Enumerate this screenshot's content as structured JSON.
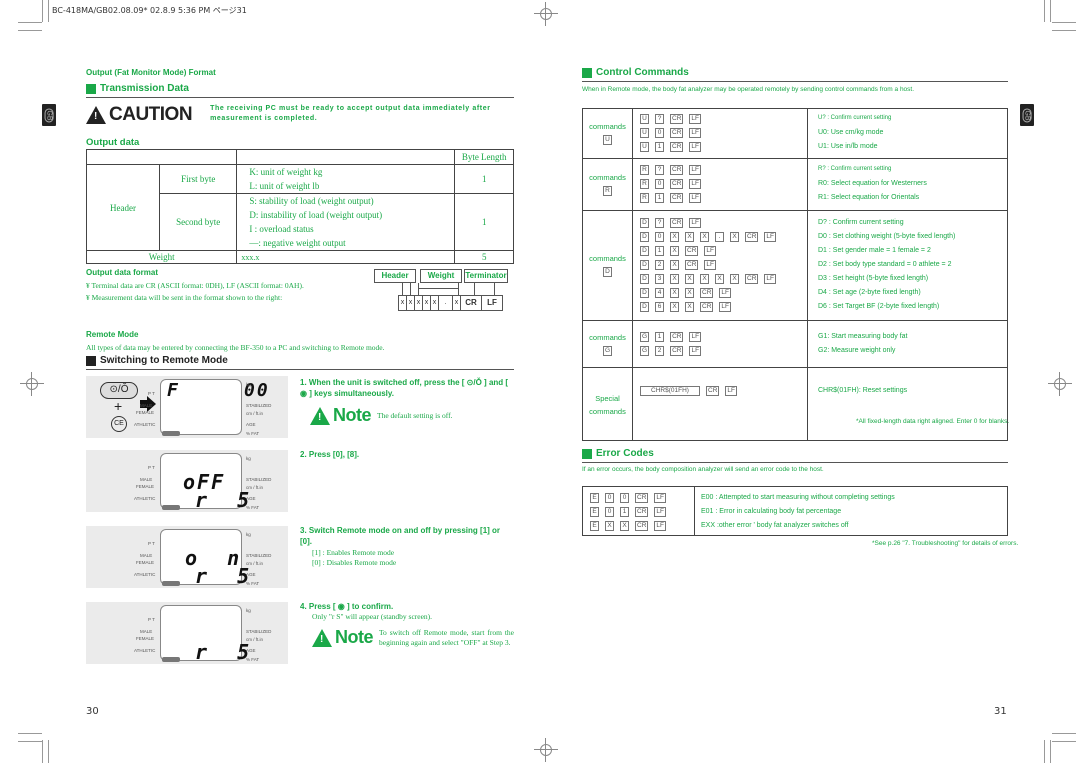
{
  "print_header": "BC-418MA/GB02.08.09* 02.8.9 5:36 PM ページ31",
  "gb_tab": "GB",
  "left_page": {
    "heading": "Output (Fat Monitor Mode) Format",
    "transmission_title": "Transmission Data",
    "caution": {
      "word": "CAUTION",
      "text": "The receiving PC must be ready to accept output data immediately after measurement is completed."
    },
    "output_data": {
      "title": "Output data",
      "byte_length_header": "Byte Length",
      "header_label": "Header",
      "first_byte": {
        "label": "First byte",
        "lines": [
          "K: unit of weight  kg",
          "L: unit of weight  lb"
        ],
        "length": "1"
      },
      "second_byte": {
        "label": "Second byte",
        "lines": [
          "S: stability of load (weight output)",
          "D: instability of load (weight output)",
          "I : overload status",
          "—: negative weight output"
        ],
        "length": "1"
      },
      "weight": {
        "label": "Weight",
        "value": "xxx.x",
        "length": "5"
      }
    },
    "output_format": {
      "title": "Output data format",
      "bullets": [
        "¥  Terminal data are CR (ASCII format: 0DH), LF (ASCII format: 0AH).",
        "¥  Measurement data will be sent in the format shown to the right:"
      ],
      "diagram": {
        "groups": [
          "Header",
          "Weight",
          "Terminator"
        ],
        "cells": [
          "x",
          "x",
          "x",
          "x",
          "x",
          ".",
          "x",
          "CR",
          "LF"
        ]
      }
    },
    "remote_mode": {
      "title": "Remote Mode",
      "text": "All types of data may be entered by connecting the BF-350 to a PC and switching to Remote mode."
    },
    "switching_title": "Switching to Remote Mode",
    "lcd_labels": {
      "left": [
        "P T",
        "MALE",
        "FEMALE",
        "ATHLETIC"
      ],
      "right": [
        "kg",
        "STABILIZED",
        "cm / ft.in",
        "AGE",
        "% FAT"
      ]
    },
    "keys": {
      "power": "⊙/Ǒ",
      "plus": "+",
      "ce": "CE"
    },
    "panels": [
      {
        "line1": "F     00",
        "line2": ""
      },
      {
        "line1": "oFF",
        "line2": "r  5"
      },
      {
        "line1": "o  n",
        "line2": "r  5"
      },
      {
        "line1": "",
        "line2": "r  5"
      }
    ],
    "steps": [
      {
        "text": "1.  When the unit is switched off, press the [ ⊙/Ǒ ] and [ ◉ ] keys simultaneously."
      },
      {
        "text": "2.  Press [0],  [8]."
      },
      {
        "text": "3.  Switch Remote mode on and off by pressing [1] or  [0].",
        "sub": [
          "[1] : Enables Remote mode",
          "[0] : Disables Remote mode"
        ]
      },
      {
        "text": "4.  Press [ ◉ ] to confirm.",
        "sub": [
          "Only \"r S\" will appear (standby screen)."
        ]
      }
    ],
    "notes": [
      {
        "word": "Note",
        "text": "The default setting is off."
      },
      {
        "word": "Note",
        "text": "To switch off Remote mode, start from the beginning again and select \"OFF\" at Step 3."
      }
    ],
    "page_number": "30"
  },
  "right_page": {
    "control_title": "Control Commands",
    "control_intro": "When in Remote mode, the body fat analyzer may be operated remotely by sending control commands from a host.",
    "command_groups": [
      {
        "label": "commands",
        "key": "U",
        "rows": [
          {
            "keys": [
              "U",
              "?",
              "CR",
              "LF"
            ],
            "desc": "U? :  Confirm current setting"
          },
          {
            "keys": [
              "U",
              "0",
              "CR",
              "LF"
            ],
            "desc": "U0: Use cm/kg mode"
          },
          {
            "keys": [
              "U",
              "1",
              "CR",
              "LF"
            ],
            "desc": "U1: Use in/lb mode"
          }
        ]
      },
      {
        "label": "commands",
        "key": "R",
        "rows": [
          {
            "keys": [
              "R",
              "?",
              "CR",
              "LF"
            ],
            "desc": "R? : Confirm current setting"
          },
          {
            "keys": [
              "R",
              "0",
              "CR",
              "LF"
            ],
            "desc": "R0: Select equation for Westerners"
          },
          {
            "keys": [
              "R",
              "1",
              "CR",
              "LF"
            ],
            "desc": "R1: Select equation for Orientals"
          }
        ]
      },
      {
        "label": "commands",
        "key": "D",
        "rows": [
          {
            "keys": [
              "D",
              "?",
              "CR",
              "LF"
            ],
            "desc": "D? : Confirm current setting"
          },
          {
            "keys": [
              "D",
              "0",
              "X",
              "X",
              "X",
              ".",
              "X",
              "CR",
              "LF"
            ],
            "desc": "D0 : Set clothing weight (5-byte fixed length)"
          },
          {
            "keys": [
              "D",
              "1",
              "X",
              "CR",
              "LF"
            ],
            "desc": "D1 : Set gender    male = 1     female = 2"
          },
          {
            "keys": [
              "D",
              "2",
              "X",
              "CR",
              "LF"
            ],
            "desc": "D2 : Set body type  standard = 0   athlete = 2"
          },
          {
            "keys": [
              "D",
              "3",
              "X",
              "X",
              "X",
              "X",
              "X",
              "CR",
              "LF"
            ],
            "desc": "D3 : Set height (5-byte fixed length)"
          },
          {
            "keys": [
              "D",
              "4",
              "X",
              "X",
              "CR",
              "LF"
            ],
            "desc": "D4 : Set age (2-byte fixed length)"
          },
          {
            "keys": [
              "D",
              "6",
              "X",
              "X",
              "CR",
              "LF"
            ],
            "desc": "D6 : Set Target BF (2-byte fixed length)"
          }
        ]
      },
      {
        "label": "commands",
        "key": "G",
        "rows": [
          {
            "keys": [
              "G",
              "1",
              "CR",
              "LF"
            ],
            "desc": "G1: Start measuring body fat"
          },
          {
            "keys": [
              "G",
              "2",
              "CR",
              "LF"
            ],
            "desc": "G2: Measure weight only"
          }
        ]
      },
      {
        "label": "Special commands",
        "key": "",
        "rows": [
          {
            "keys": [
              "CHR$(01FH)",
              "CR",
              "LF"
            ],
            "desc": "CHR$(01FH): Reset settings"
          }
        ]
      }
    ],
    "control_footnote": "*All fixed-length data right aligned. Enter  0  for blanks.",
    "error_title": "Error Codes",
    "error_intro": "If an error occurs, the body composition analyzer will send an error code to the host.",
    "errors": [
      {
        "keys": [
          "E",
          "0",
          "0",
          "CR",
          "LF"
        ],
        "desc": "E00 : Attempted to start measuring without completing settings"
      },
      {
        "keys": [
          "E",
          "0",
          "1",
          "CR",
          "LF"
        ],
        "desc": "E01 : Error in calculating body fat percentage"
      },
      {
        "keys": [
          "E",
          "X",
          "X",
          "CR",
          "LF"
        ],
        "desc": "EXX :other error ' body fat analyzer switches off"
      }
    ],
    "error_footnote": "*See p.26 \"7. Troubleshooting\" for details of errors.",
    "page_number": "31"
  }
}
